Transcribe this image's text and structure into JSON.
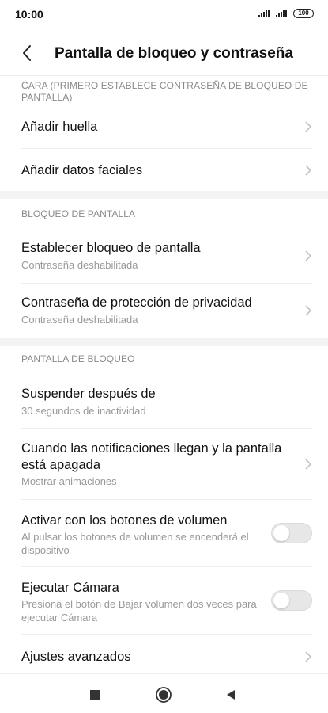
{
  "status": {
    "time": "10:00",
    "battery": "100"
  },
  "header": {
    "title": "Pantalla de bloqueo y contraseña"
  },
  "sections": {
    "face_label": "CARA (PRIMERO ESTABLECE CONTRASEÑA DE BLOQUEO DE PANTALLA)",
    "lock_label": "BLOQUEO DE PANTALLA",
    "lockscreen_label": "PANTALLA DE BLOQUEO"
  },
  "items": {
    "fingerprint": {
      "title": "Añadir huella"
    },
    "face": {
      "title": "Añadir datos faciales"
    },
    "screen_lock": {
      "title": "Establecer bloqueo de pantalla",
      "subtitle": "Contraseña deshabilitada"
    },
    "privacy": {
      "title": "Contraseña de protección de privacidad",
      "subtitle": "Contraseña deshabilitada"
    },
    "sleep": {
      "title": "Suspender después de",
      "subtitle": "30 segundos de inactividad"
    },
    "notifications": {
      "title": "Cuando las notificaciones llegan y la pantalla está apagada",
      "subtitle": "Mostrar animaciones"
    },
    "volume_wake": {
      "title": "Activar con los botones de volumen",
      "subtitle": "Al pulsar los botones de volumen se encenderá el dispositivo",
      "enabled": false
    },
    "camera": {
      "title": "Ejecutar Cámara",
      "subtitle": "Presiona el botón de Bajar volumen dos veces para ejecutar Cámara",
      "enabled": false
    },
    "advanced": {
      "title": "Ajustes avanzados"
    }
  },
  "colors": {
    "text_primary": "#111111",
    "text_secondary": "#999999",
    "section_label": "#8a8a8a",
    "toggle_off": "#e7e7e7"
  },
  "icons": {
    "back": "back-arrow-icon",
    "chevron": "chevron-right-icon",
    "nav_recents": "square-icon",
    "nav_home": "circle-icon",
    "nav_back": "triangle-back-icon"
  }
}
